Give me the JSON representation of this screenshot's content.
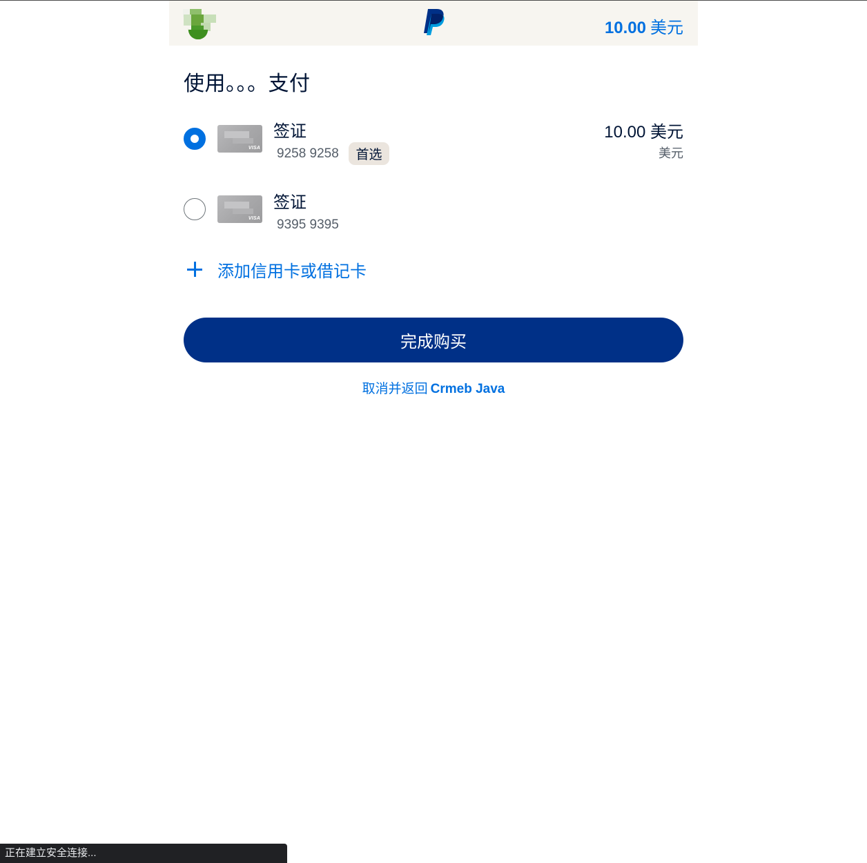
{
  "header": {
    "amount_value": "10.00",
    "amount_currency": "美元",
    "logo": "paypal-logo",
    "avatar": "merchant-avatar"
  },
  "pay_title": "使用。。。支付",
  "methods": [
    {
      "selected": true,
      "card_brand": "VISA",
      "name": "签证",
      "number": "9258 9258",
      "badge": "首选",
      "amount": "10.00 美元",
      "currency": "美元"
    },
    {
      "selected": false,
      "card_brand": "VISA",
      "name": "签证",
      "number": "9395 9395"
    }
  ],
  "add_card_label": "添加信用卡或借记卡",
  "complete_button": "完成购买",
  "cancel": {
    "text": "取消并返回",
    "merchant": "Crmeb Java"
  },
  "status_bar": "正在建立安全连接...",
  "colors": {
    "accent": "#0070e0",
    "primary_button": "#003087",
    "header_bg": "#f7f5f0",
    "badge_bg": "#ebe5de"
  }
}
